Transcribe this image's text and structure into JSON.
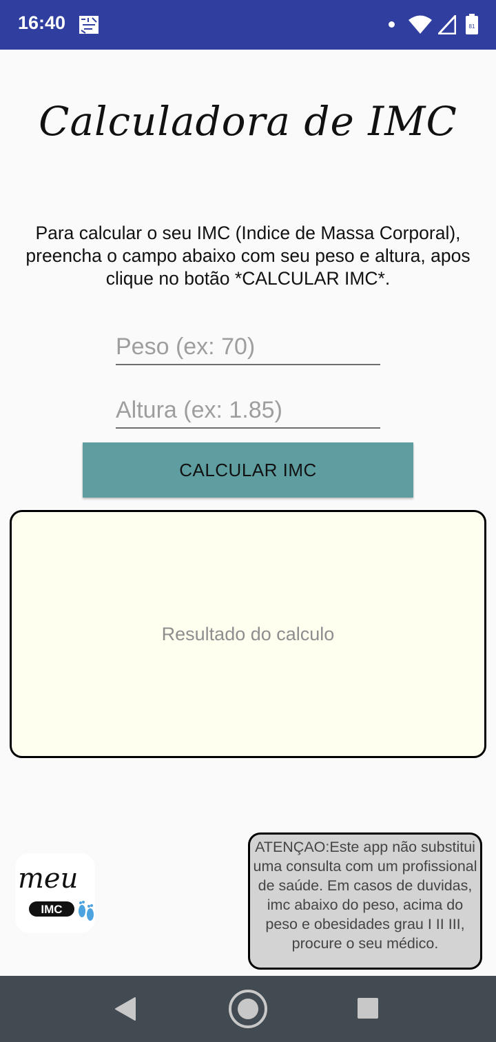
{
  "status_bar": {
    "time": "16:40",
    "icons": [
      "app-notification-icon",
      "notification-dot-icon",
      "wifi-icon",
      "signal-icon",
      "battery-icon"
    ],
    "background": "#303f9f"
  },
  "app": {
    "title": "Calculadora de IMC",
    "instructions": "Para calcular o seu IMC (Indice de Massa Corporal), preencha o campo abaixo com seu peso e altura, apos clique no botão *CALCULAR IMC*.",
    "weight_input": {
      "value": "",
      "placeholder": "Peso (ex: 70)"
    },
    "height_input": {
      "value": "",
      "placeholder": "Altura (ex: 1.85)"
    },
    "calculate_button": "CALCULAR IMC",
    "result_text": "Resultado do calculo",
    "logo": {
      "word1": "meu",
      "word2": "IMC"
    },
    "warning": "ATENÇAO:Este app não substitui uma consulta com um profissional de saúde. Em casos de duvidas, imc abaixo do peso, acima do peso e obesidades grau I II III, procure o seu médico.",
    "colors": {
      "button": "#5f9ea0",
      "result_background": "#fffff0",
      "warning_background": "#d3d3d3"
    }
  },
  "nav_bar": {
    "icons": [
      "back-icon",
      "home-icon",
      "recents-icon"
    ],
    "background": "#424a52"
  }
}
